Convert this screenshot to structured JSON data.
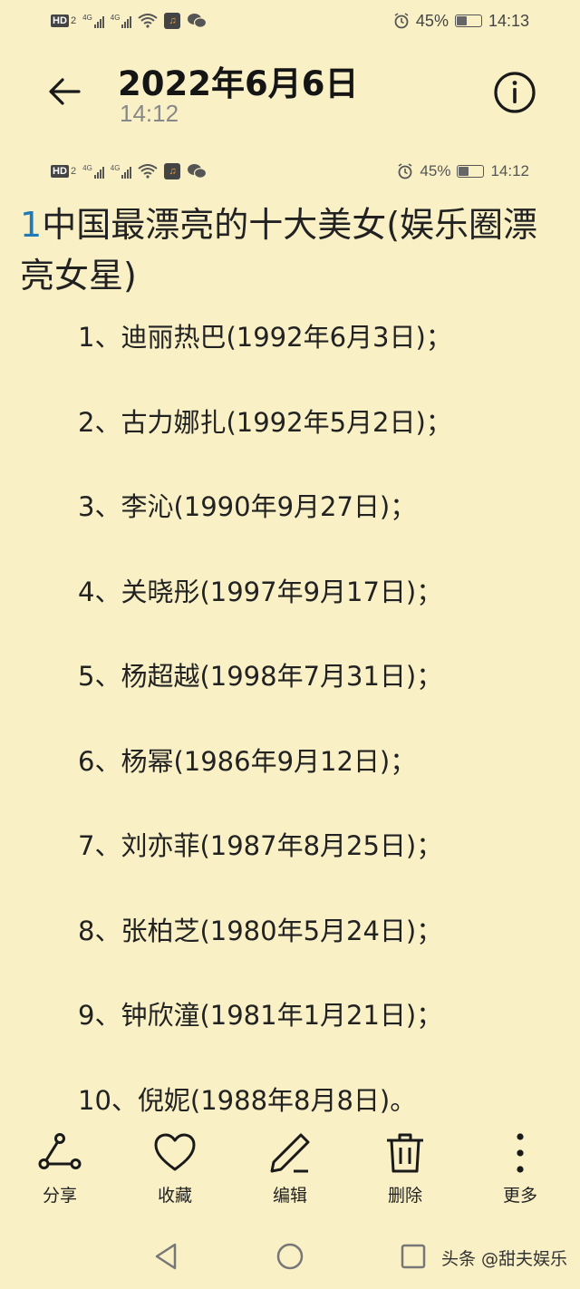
{
  "status_bar": {
    "hd": "HD",
    "sim": "2",
    "net1": "4G",
    "net2": "4G",
    "battery_pct": "45%",
    "battery_level": 0.45,
    "time": "14:13"
  },
  "screenshot_status_bar": {
    "battery_pct": "45%",
    "time": "14:12"
  },
  "header": {
    "title": "2022年6月6日",
    "subtitle": "14:12"
  },
  "note": {
    "title_number": "1",
    "title_text": "中国最漂亮的十大美女(娱乐圈漂亮女星)",
    "items": [
      "1、迪丽热巴(1992年6月3日)；",
      "2、古力娜扎(1992年5月2日)；",
      "3、李沁(1990年9月27日)；",
      "4、关晓彤(1997年9月17日)；",
      "5、杨超越(1998年7月31日)；",
      "6、杨幂(1986年9月12日)；",
      "7、刘亦菲(1987年8月25日)；",
      "8、张柏芝(1980年5月24日)；",
      "9、钟欣潼(1981年1月21日)；",
      "10、倪妮(1988年8月8日)。"
    ]
  },
  "toolbar": {
    "share": "分享",
    "favorite": "收藏",
    "edit": "编辑",
    "delete": "删除",
    "more": "更多"
  },
  "watermark": "头条 @甜夫娱乐",
  "icons": [
    "back-arrow-icon",
    "info-icon",
    "share-icon",
    "heart-icon",
    "pen-icon",
    "trash-icon",
    "more-vertical-icon",
    "nav-back-icon",
    "nav-home-icon",
    "nav-recents-icon"
  ],
  "colors": {
    "background": "#f9f0c6",
    "title_number": "#1f7ab8",
    "text": "#222222"
  }
}
